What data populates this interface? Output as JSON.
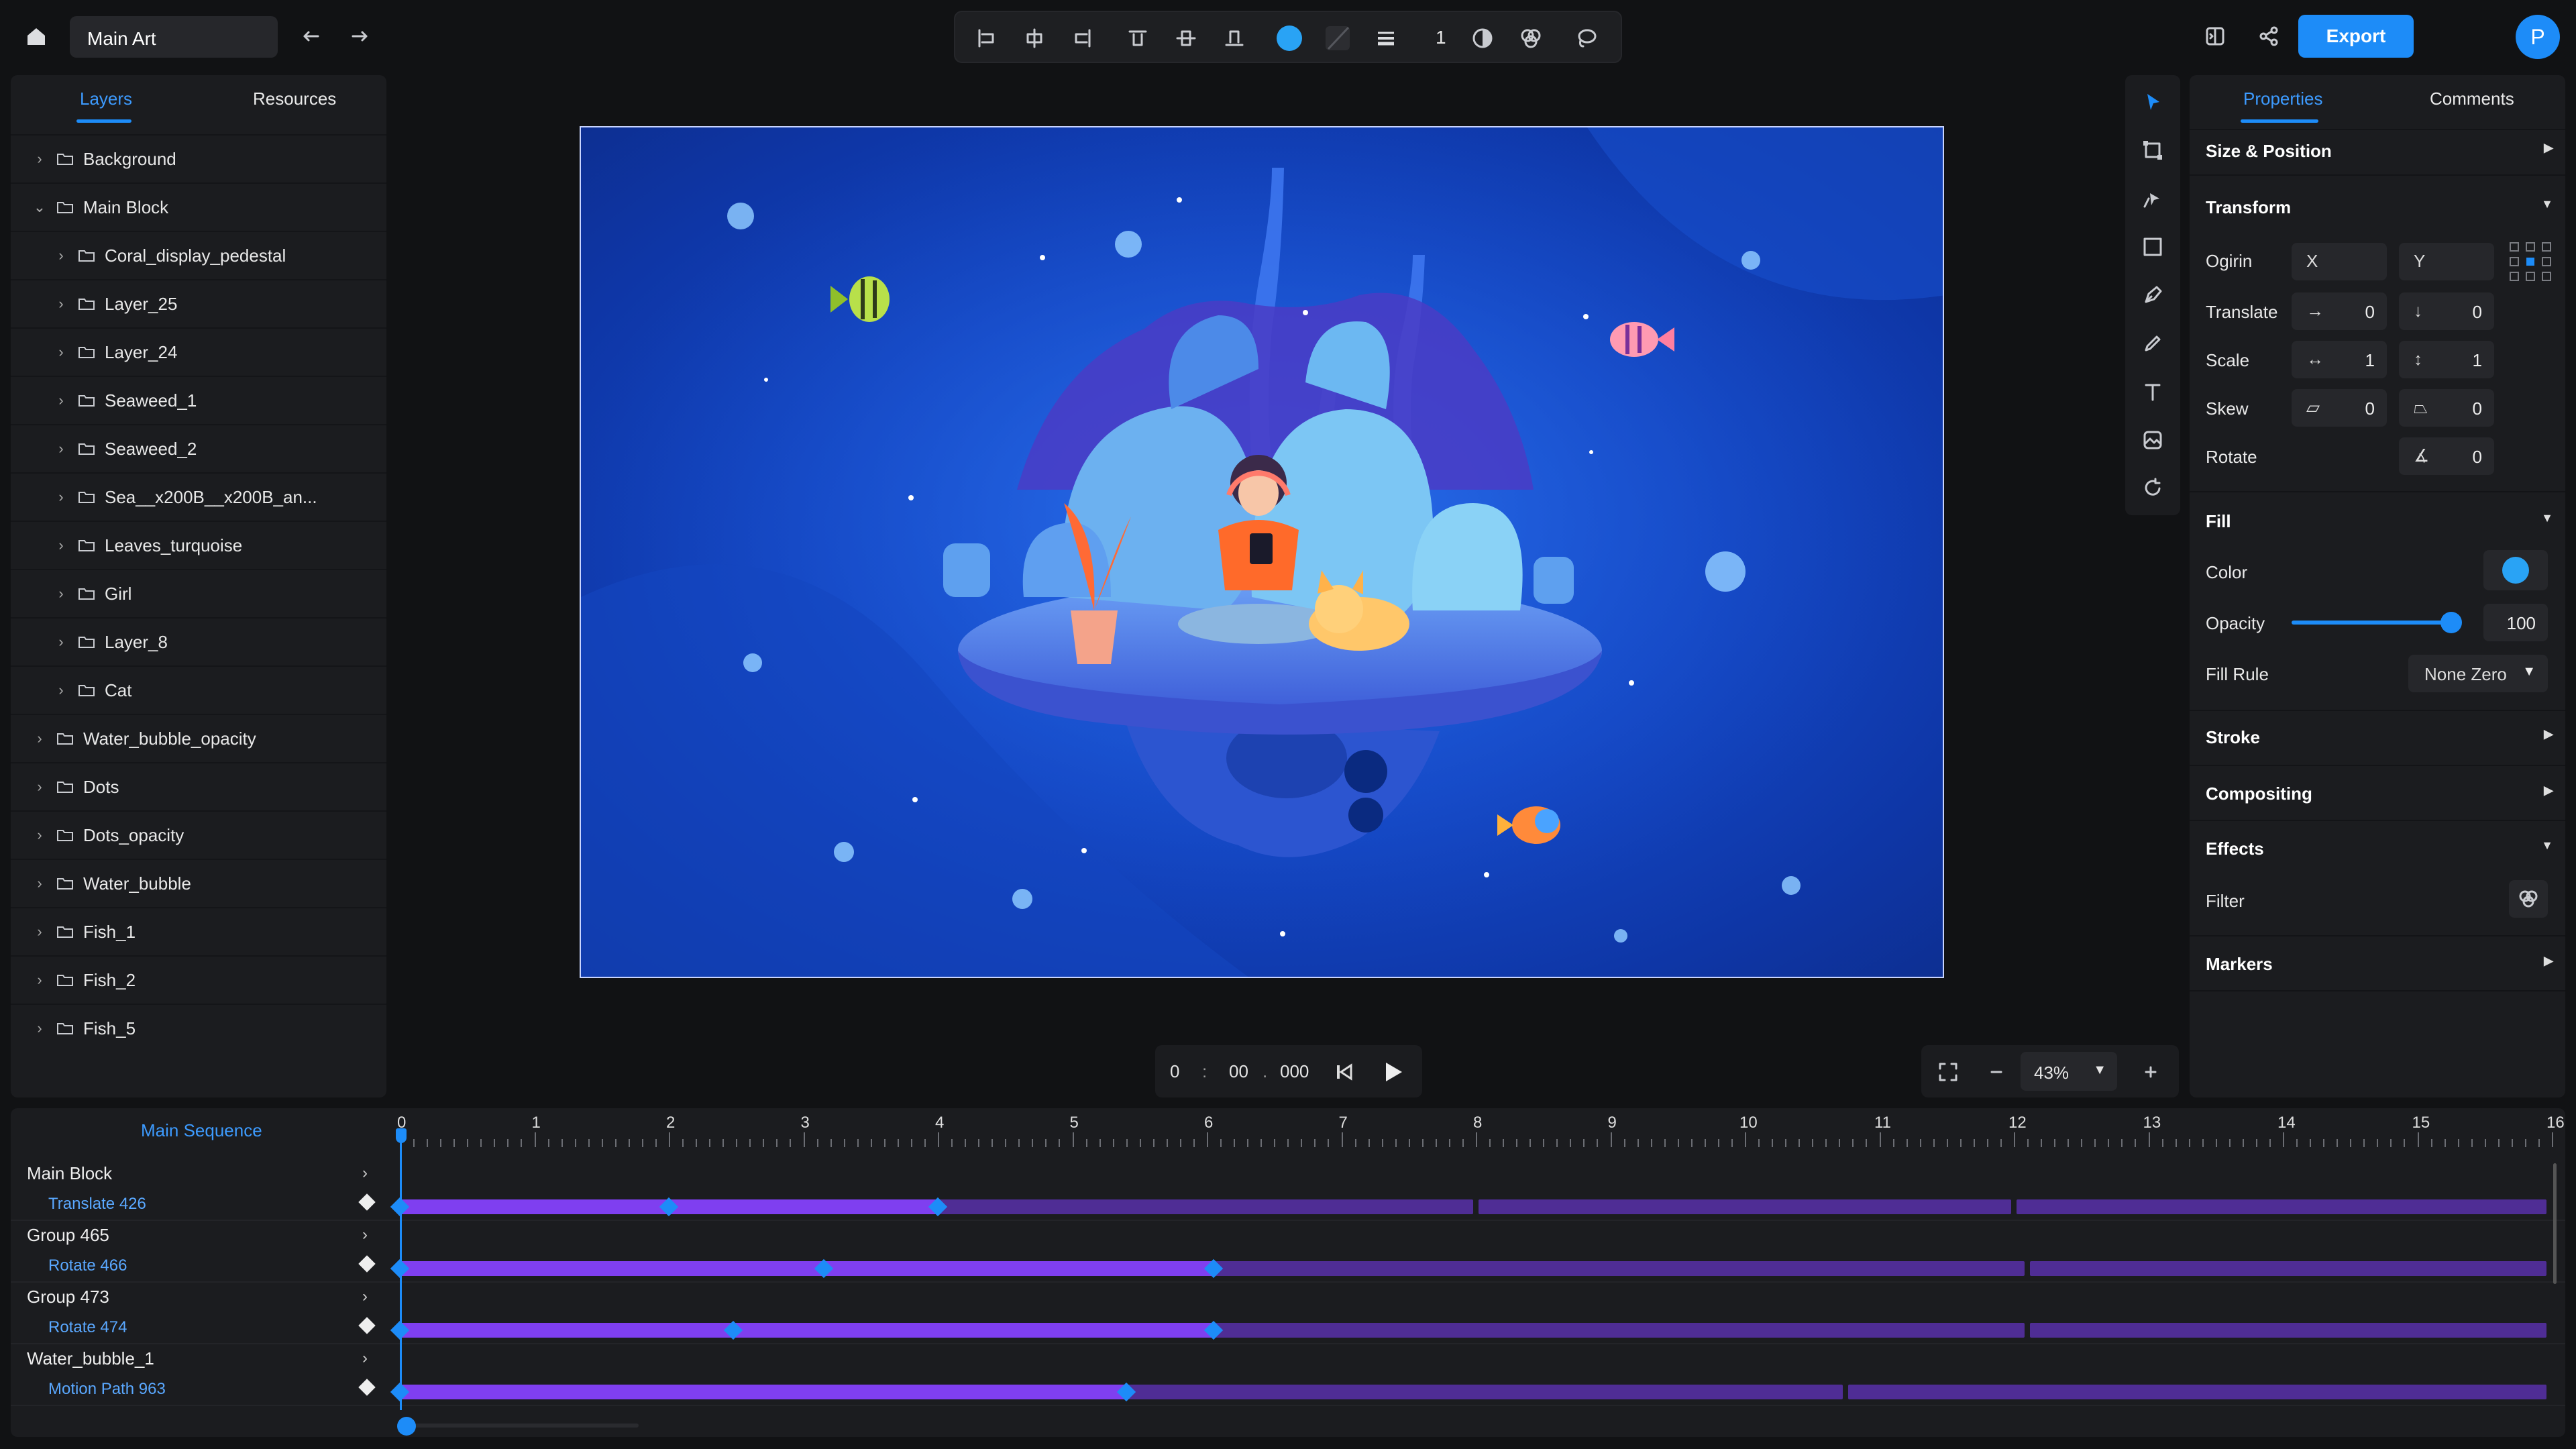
{
  "header": {
    "doc_name": "Main Art",
    "stroke_width": "1",
    "export_label": "Export",
    "avatar_initial": "P"
  },
  "layers_panel": {
    "tabs": [
      "Layers",
      "Resources"
    ],
    "active_tab": "Layers",
    "items": [
      {
        "label": "Background",
        "depth": 0,
        "expanded": false
      },
      {
        "label": "Main Block",
        "depth": 0,
        "expanded": true
      },
      {
        "label": "Coral_display_pedestal",
        "depth": 1,
        "expanded": false
      },
      {
        "label": "Layer_25",
        "depth": 1,
        "expanded": false
      },
      {
        "label": "Layer_24",
        "depth": 1,
        "expanded": false
      },
      {
        "label": "Seaweed_1",
        "depth": 1,
        "expanded": false
      },
      {
        "label": "Seaweed_2",
        "depth": 1,
        "expanded": false
      },
      {
        "label": "Sea__x200B__x200B_an...",
        "depth": 1,
        "expanded": false
      },
      {
        "label": "Leaves_turquoise",
        "depth": 1,
        "expanded": false
      },
      {
        "label": "Girl",
        "depth": 1,
        "expanded": false
      },
      {
        "label": "Layer_8",
        "depth": 1,
        "expanded": false
      },
      {
        "label": "Cat",
        "depth": 1,
        "expanded": false
      },
      {
        "label": "Water_bubble_opacity",
        "depth": 0,
        "expanded": false
      },
      {
        "label": "Dots",
        "depth": 0,
        "expanded": false
      },
      {
        "label": "Dots_opacity",
        "depth": 0,
        "expanded": false
      },
      {
        "label": "Water_bubble",
        "depth": 0,
        "expanded": false
      },
      {
        "label": "Fish_1",
        "depth": 0,
        "expanded": false
      },
      {
        "label": "Fish_2",
        "depth": 0,
        "expanded": false
      },
      {
        "label": "Fish_5",
        "depth": 0,
        "expanded": false
      }
    ]
  },
  "properties_panel": {
    "tabs": [
      "Properties",
      "Comments"
    ],
    "active_tab": "Properties",
    "sections": {
      "size_position": "Size & Position",
      "transform": "Transform",
      "fill": "Fill",
      "stroke": "Stroke",
      "compositing": "Compositing",
      "effects": "Effects",
      "markers": "Markers"
    },
    "transform": {
      "origin_label": "Ogirin",
      "origin_x": "X",
      "origin_y": "Y",
      "translate_label": "Translate",
      "translate_x": "0",
      "translate_y": "0",
      "scale_label": "Scale",
      "scale_x": "1",
      "scale_y": "1",
      "skew_label": "Skew",
      "skew_x": "0",
      "skew_y": "0",
      "rotate_label": "Rotate",
      "rotate": "0"
    },
    "fill": {
      "color_label": "Color",
      "color": "#29a3f5",
      "opacity_label": "Opacity",
      "opacity": "100",
      "opacity_fraction": 1.0,
      "rule_label": "Fill Rule",
      "rule": "None Zero"
    },
    "effects": {
      "filter_label": "Filter"
    }
  },
  "playback": {
    "time_min": "0",
    "time_sec": "00",
    "time_ms": "000"
  },
  "zoom": {
    "level": "43%"
  },
  "timeline": {
    "sequence_name": "Main Sequence",
    "ticks": [
      "0",
      "1",
      "2",
      "3",
      "4",
      "5",
      "6",
      "7",
      "8",
      "9",
      "10",
      "11",
      "12",
      "13",
      "14",
      "15",
      "16"
    ],
    "tracks": [
      {
        "group": "Main Block",
        "property": "Translate 426",
        "keyframes": [
          0,
          2,
          4
        ],
        "active_end": 4,
        "segment_breaks": [
          8,
          12
        ]
      },
      {
        "group": "Group 465",
        "property": "Rotate 466",
        "keyframes": [
          0,
          3.15,
          6.05
        ],
        "active_end": 6.05,
        "segment_breaks": [
          12.1
        ]
      },
      {
        "group": "Group 473",
        "property": "Rotate 474",
        "keyframes": [
          0,
          2.48,
          6.05
        ],
        "active_end": 6.05,
        "segment_breaks": [
          12.1
        ]
      },
      {
        "group": "Water_bubble_1",
        "property": "Motion Path 963",
        "keyframes": [
          0,
          5.4
        ],
        "active_end": 5.4,
        "segment_breaks": [
          10.75
        ]
      }
    ]
  },
  "colors": {
    "accent": "#1d8cf8",
    "track_active": "#7f3ff0",
    "track_inactive": "#4f2d95"
  }
}
